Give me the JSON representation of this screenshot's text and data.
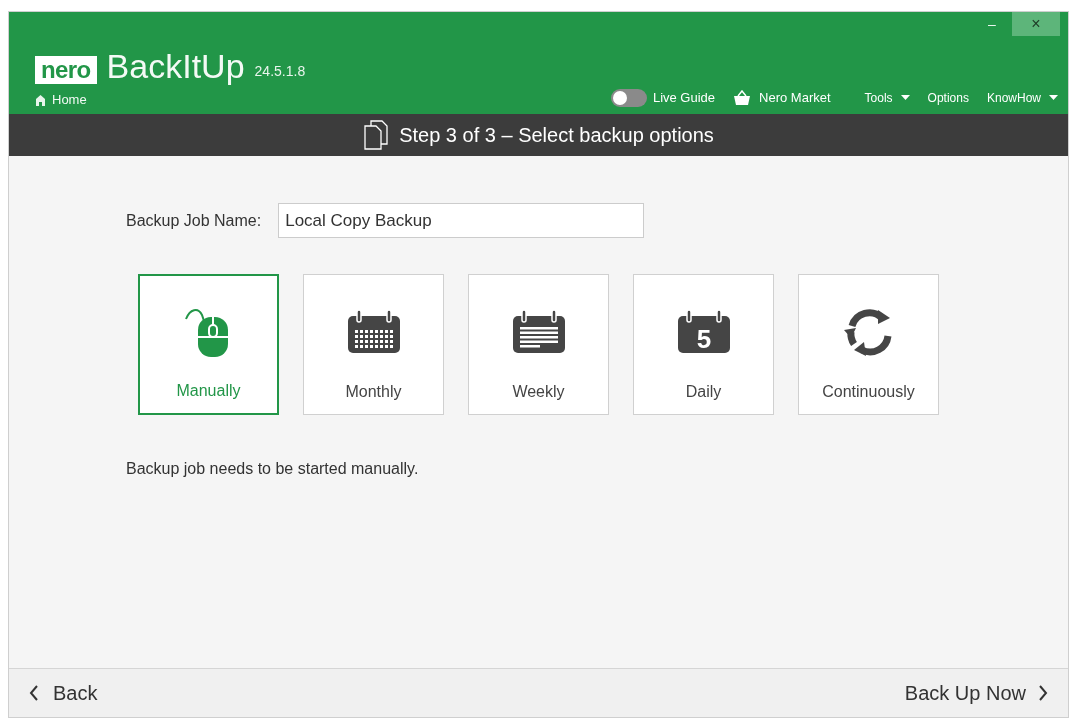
{
  "header": {
    "logo": "nero",
    "app_name": "BackItUp",
    "version": "24.5.1.8",
    "home": "Home",
    "live_guide": {
      "label": "Live Guide",
      "on": false
    },
    "market": "Nero Market",
    "menus": [
      {
        "label": "Tools",
        "dropdown": true
      },
      {
        "label": "Options",
        "dropdown": false
      },
      {
        "label": "KnowHow",
        "dropdown": true
      }
    ],
    "window_controls": {
      "minimize": "–",
      "close": "×"
    }
  },
  "step_bar": {
    "title": "Step 3 of 3 – Select backup options"
  },
  "job_name": {
    "label": "Backup Job Name:",
    "value": "Local Copy Backup"
  },
  "schedule_options": [
    {
      "kind": "mouse",
      "label": "Manually",
      "selected": true
    },
    {
      "kind": "month",
      "label": "Monthly",
      "selected": false
    },
    {
      "kind": "week",
      "label": "Weekly",
      "selected": false
    },
    {
      "kind": "day",
      "label": "Daily",
      "selected": false,
      "icon_text": "5"
    },
    {
      "kind": "continuous",
      "label": "Continuously",
      "selected": false
    }
  ],
  "description": "Backup job needs to be started manually.",
  "footer": {
    "back": "Back",
    "next": "Back Up Now"
  }
}
